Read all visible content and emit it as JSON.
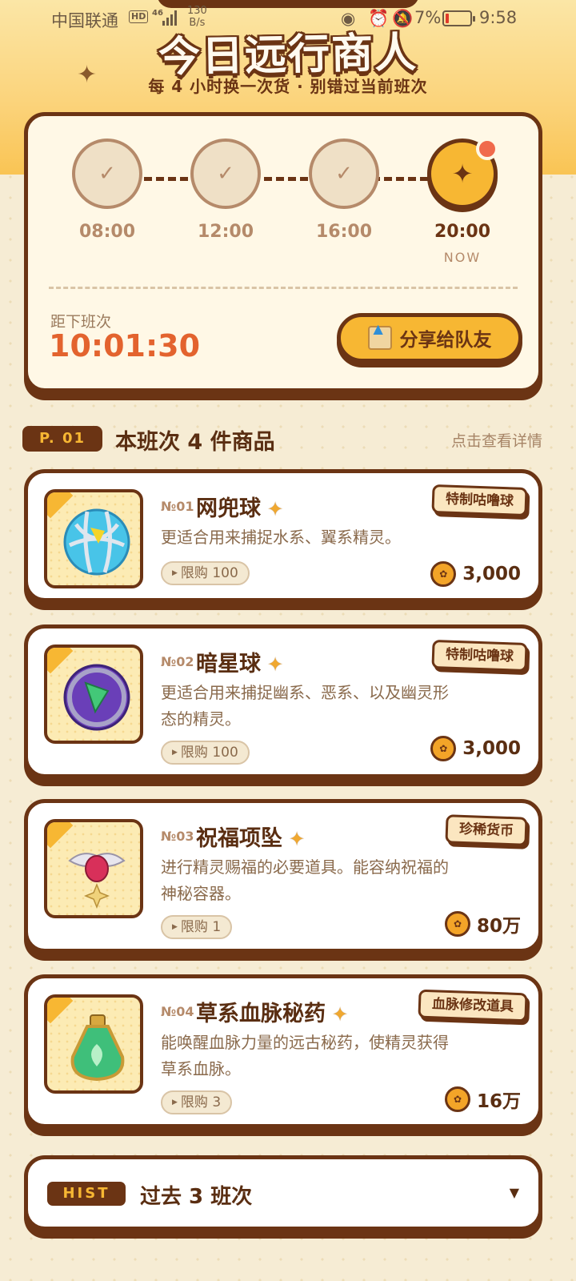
{
  "status_bar": {
    "carrier": "中国联通",
    "hd": "HD",
    "network": "46",
    "speed_value": "130",
    "speed_unit": "B/s",
    "battery": "7%",
    "time": "9:58"
  },
  "header": {
    "title": "今日远行商人",
    "subtitle": "每 4 小时换一次货 · 别错过当前班次"
  },
  "schedule": {
    "slots": [
      {
        "time": "08:00",
        "state": "done"
      },
      {
        "time": "12:00",
        "state": "done"
      },
      {
        "time": "16:00",
        "state": "done"
      },
      {
        "time": "20:00",
        "state": "now",
        "now_label": "NOW"
      }
    ],
    "next_label": "距下班次",
    "countdown": "10:01:30",
    "share_label": "分享给队友"
  },
  "section": {
    "tag": "P. 01",
    "title": "本班次 4 件商品",
    "link": "点击查看详情"
  },
  "items": [
    {
      "no": "№01",
      "name": "网兜球",
      "desc": "更适合用来捕捉水系、翼系精灵。",
      "limit": "限购 100",
      "badge": "特制咕噜球",
      "price": "3,000",
      "icon": "net-ball-icon"
    },
    {
      "no": "№02",
      "name": "暗星球",
      "desc": "更适合用来捕捉幽系、恶系、以及幽灵形态的精灵。",
      "limit": "限购 100",
      "badge": "特制咕噜球",
      "price": "3,000",
      "icon": "dark-star-ball-icon"
    },
    {
      "no": "№03",
      "name": "祝福项坠",
      "desc": "进行精灵赐福的必要道具。能容纳祝福的神秘容器。",
      "limit": "限购 1",
      "badge": "珍稀货币",
      "price": "80万",
      "icon": "blessing-pendant-icon"
    },
    {
      "no": "№04",
      "name": "草系血脉秘药",
      "desc": "能唤醒血脉力量的远古秘药，使精灵获得草系血脉。",
      "limit": "限购 3",
      "badge": "血脉修改道具",
      "price": "16万",
      "icon": "grass-potion-icon"
    }
  ],
  "history": {
    "tag": "HIST",
    "label": "过去 3 班次"
  },
  "colors": {
    "brown": "#6b3414",
    "gold": "#f7b733",
    "accent_orange": "#e3632e",
    "cream": "#fff8e6"
  }
}
